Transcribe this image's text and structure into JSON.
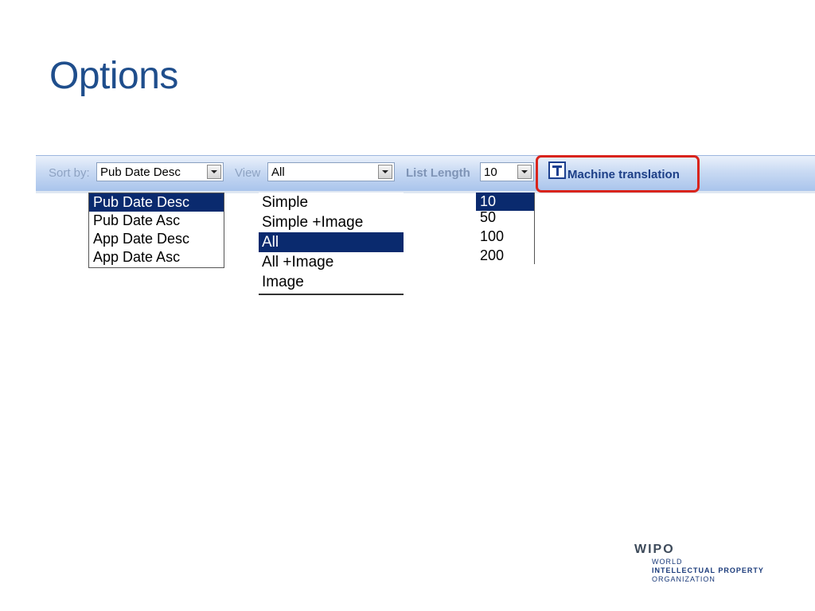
{
  "slide": {
    "title": "Options"
  },
  "toolbar": {
    "sort_label": "Sort by:",
    "sort_value": "Pub Date Desc",
    "view_label": "View",
    "view_value": "All",
    "list_length_label": "List Length",
    "list_length_value": "10",
    "machine_translation_label": "Machine translation"
  },
  "sort_dropdown": {
    "options": [
      "Pub Date Desc",
      "Pub Date Asc",
      "App Date Desc",
      "App Date Asc"
    ],
    "selected_index": 0
  },
  "view_dropdown": {
    "options": [
      "Simple",
      "Simple +Image",
      "All",
      "All +Image",
      "Image"
    ],
    "selected_index": 2
  },
  "list_length_dropdown": {
    "options": [
      "10",
      "50",
      "100",
      "200"
    ],
    "selected_index": 0
  },
  "logo": {
    "name": "WIPO",
    "line1": "WORLD",
    "line2": "INTELLECTUAL PROPERTY",
    "line3": "ORGANIZATION"
  },
  "colors": {
    "title": "#1f4e8c",
    "selection": "#0a2a6e",
    "highlight_border": "#d9241c"
  }
}
